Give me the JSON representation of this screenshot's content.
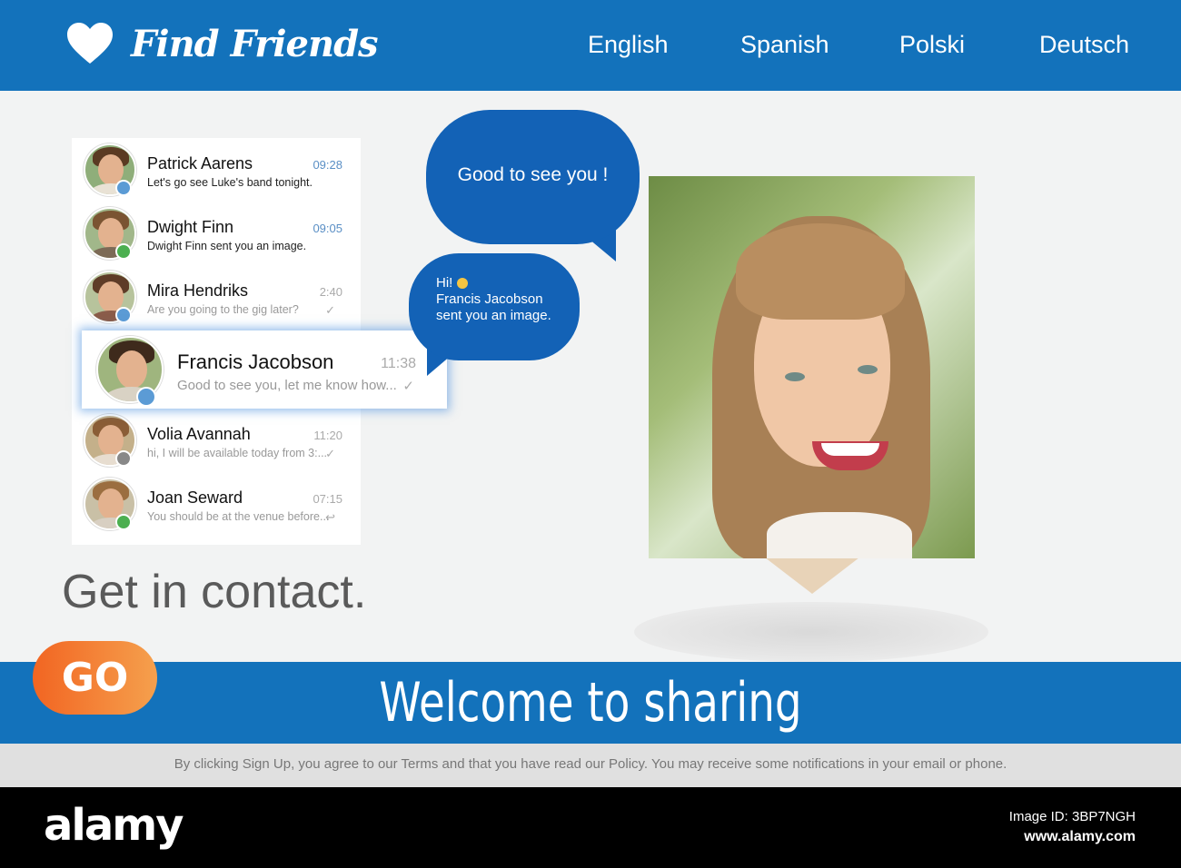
{
  "header": {
    "app_title": "Find Friends",
    "languages": [
      "English",
      "Spanish",
      "Polski",
      "Deutsch"
    ]
  },
  "chats": [
    {
      "name": "Patrick Aarens",
      "time": "09:28",
      "message": "Let's go see Luke's band tonight.",
      "status_color": "#5b9bd5",
      "read": false
    },
    {
      "name": "Dwight Finn",
      "time": "09:05",
      "message": "Dwight Finn sent you an image.",
      "status_color": "#4caf50",
      "read": false
    },
    {
      "name": "Mira Hendriks",
      "time": "2:40",
      "message": "Are you going to the gig later?",
      "status_color": "#5b9bd5",
      "read": true
    },
    {
      "name": "Francis Jacobson",
      "time": "11:38",
      "message": "Good to see you, let me know how...",
      "status_color": "#5b9bd5",
      "read": true
    },
    {
      "name": "Volia Avannah",
      "time": "11:20",
      "message": "hi, I will be available today from 3:...",
      "status_color": "#888888",
      "read": true
    },
    {
      "name": "Joan Seward",
      "time": "07:15",
      "message": "You should be at the venue before...",
      "status_color": "#4caf50",
      "read": true
    }
  ],
  "bubbles": {
    "big": "Good to see you !",
    "small_greeting": "Hi!",
    "small_message": "Francis Jacobson sent you an image."
  },
  "headline": "Get in contact.",
  "banner": {
    "go_label": "GO",
    "title": "Welcome to sharing"
  },
  "terms": "By clicking Sign Up, you agree to our Terms and that you have read our Policy. You may receive some notifications in your email or phone.",
  "footer": {
    "brand": "alamy",
    "image_id": "Image ID: 3BP7NGH",
    "url": "www.alamy.com"
  },
  "colors": {
    "brand_blue": "#1372bb",
    "bubble_blue": "#1362b6",
    "go_orange": "#f26522"
  },
  "icons": [
    "heart-icon",
    "check-icon",
    "emoji-icon"
  ]
}
